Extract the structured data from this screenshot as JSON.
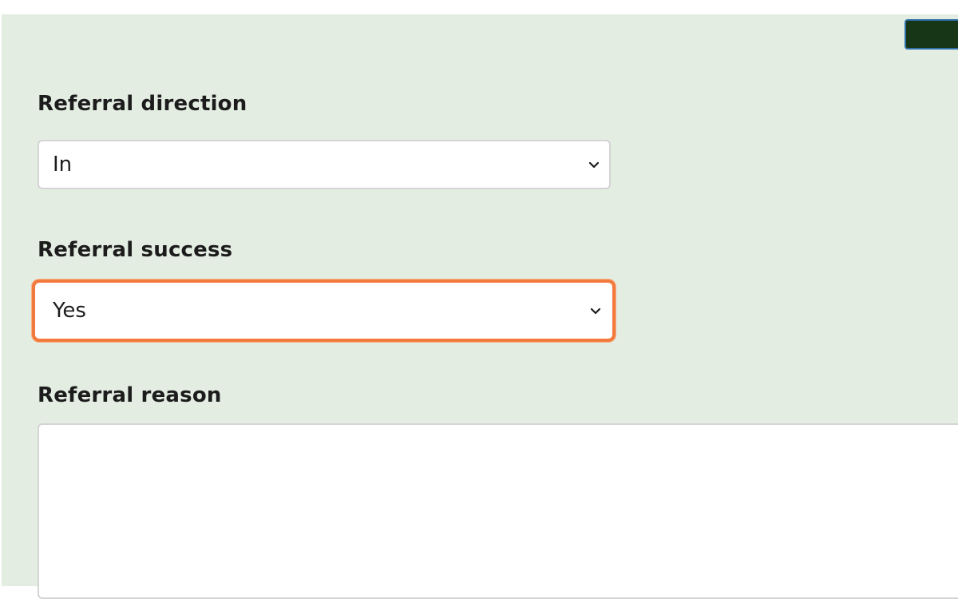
{
  "form": {
    "referral_direction": {
      "label": "Referral direction",
      "selected": "In"
    },
    "referral_success": {
      "label": "Referral success",
      "selected": "Yes"
    },
    "referral_reason": {
      "label": "Referral reason",
      "value": ""
    }
  },
  "colors": {
    "panel_background": "#e3ede2",
    "focus_outline": "#f37a3d",
    "top_button": "#173618"
  },
  "icons": {
    "select_arrow": "chevron-down-icon"
  }
}
